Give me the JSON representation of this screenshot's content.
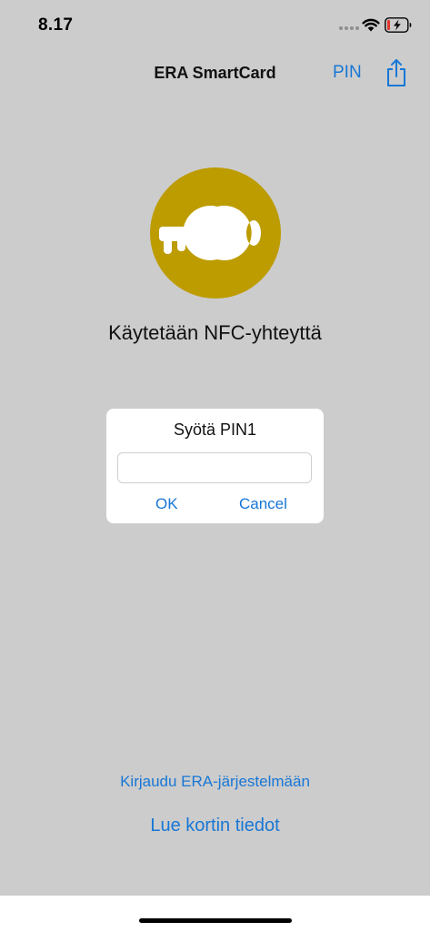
{
  "status_bar": {
    "time": "8.17",
    "icons": [
      "signal-icon",
      "wifi-icon",
      "battery-charging-icon"
    ]
  },
  "nav": {
    "title": "ERA SmartCard",
    "pin_button": "PIN",
    "share_icon": "share-icon"
  },
  "main": {
    "key_icon": "key-icon",
    "nfc_status": "Käytetään NFC-yhteyttä"
  },
  "dialog": {
    "title": "Syötä PIN1",
    "input_value": "",
    "ok_label": "OK",
    "cancel_label": "Cancel"
  },
  "links": {
    "login": "Kirjaudu ERA-järjestelmään",
    "read_card": "Lue kortin tiedot"
  },
  "colors": {
    "background": "#cccccc",
    "accent": "#1877d6",
    "key_circle": "#bd9c00",
    "battery_low": "#e0362e"
  }
}
